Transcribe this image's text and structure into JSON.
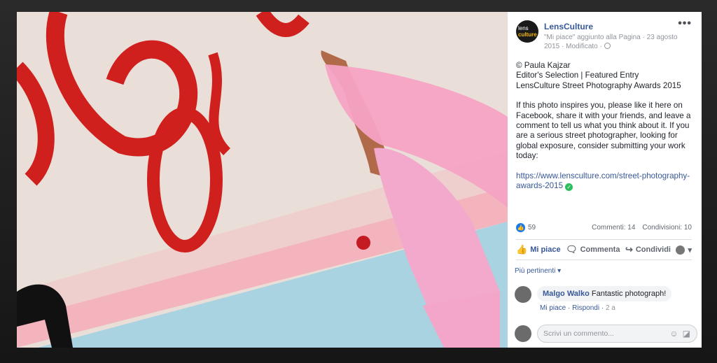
{
  "page": {
    "name": "LensCulture",
    "avatar_line1": "lens",
    "avatar_line2": "culture",
    "activity": "\"Mi piace\" aggiunto alla Pagina",
    "date": "23 agosto 2015",
    "edited": "Modificato"
  },
  "post": {
    "credit": "© Paula Kajzar",
    "selection": "Editor's Selection | Featured Entry",
    "award": "LensCulture Street Photography Awards 2015",
    "message": "If this photo inspires you, please like it here on Facebook, share it with your friends, and leave a comment to tell us what you think about it. If you are a serious street photographer, looking for global exposure, consider submitting your work today:",
    "link": "https://www.lensculture.com/street-photography-awards-2015"
  },
  "counts": {
    "likes": "59",
    "comments": "Commenti: 14",
    "shares": "Condivisioni: 10"
  },
  "actions": {
    "like": "Mi piace",
    "comment": "Commenta",
    "share": "Condividi"
  },
  "filter": "Più pertinenti",
  "comment1": {
    "author": "Malgo Walko",
    "text": "Fantastic photograph!",
    "like": "Mi piace",
    "reply": "Rispondi",
    "age": "2 a"
  },
  "composer": {
    "placeholder": "Scrivi un commento..."
  },
  "icons": [
    "more-icon",
    "globe-icon",
    "like-thumb-icon",
    "comment-icon",
    "share-icon",
    "emoji-icon",
    "sticker-icon",
    "verified-check-icon"
  ],
  "colors": {
    "link": "#385898",
    "accent": "#1877f2",
    "check": "#2bbf60"
  }
}
